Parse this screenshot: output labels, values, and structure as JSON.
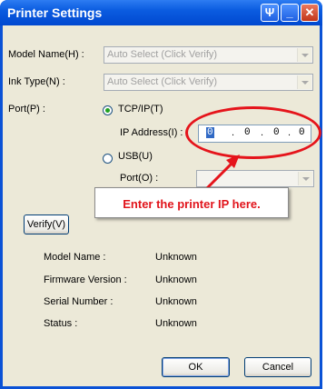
{
  "window": {
    "title": "Printer Settings",
    "help_glyph": "Ψ",
    "min_glyph": "_",
    "close_glyph": "✕"
  },
  "model_name": {
    "label": "Model Name(H) :",
    "value": "Auto Select (Click Verify)"
  },
  "ink_type": {
    "label": "Ink Type(N) :",
    "value": "Auto Select (Click Verify)"
  },
  "port": {
    "label": "Port(P) :",
    "tcp_label": "TCP/IP(T)",
    "tcp_selected": true,
    "ip_label": "IP Address(I) :",
    "ip_octets": [
      "0",
      "0",
      "0",
      "0"
    ],
    "usb_label": "USB(U)",
    "usb_port_label": "Port(O) :"
  },
  "annotation": {
    "text": "Enter the printer IP here.",
    "color": "#e5141b"
  },
  "verify_button": "Verify(V)",
  "info": {
    "rows": [
      {
        "label": "Model Name :",
        "value": "Unknown"
      },
      {
        "label": "Firmware Version :",
        "value": "Unknown"
      },
      {
        "label": "Serial Number :",
        "value": "Unknown"
      },
      {
        "label": "Status :",
        "value": "Unknown"
      }
    ]
  },
  "buttons": {
    "ok": "OK",
    "cancel": "Cancel"
  },
  "colors": {
    "titlebar": "#0a52d6",
    "dialog_bg": "#ece9d8",
    "accent_red": "#e5141b"
  }
}
